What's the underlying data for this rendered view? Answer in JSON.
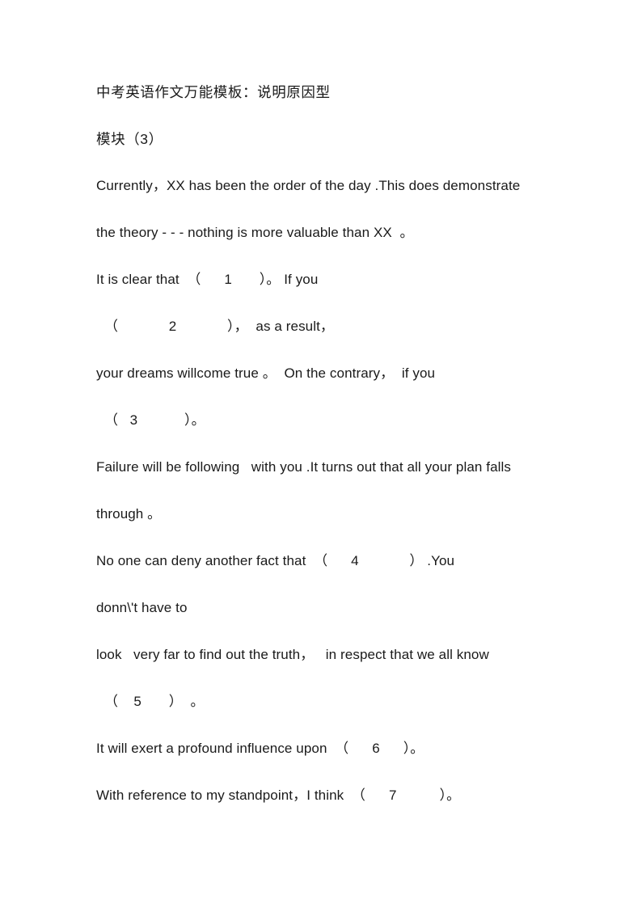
{
  "document": {
    "title": "中考英语作文万能模板：说明原因型",
    "section": "模块（3）",
    "text_color": "#1a1a1a",
    "background_color": "#ffffff",
    "lines": [
      {
        "id": "title",
        "text": "中考英语作文万能模板：说明原因型",
        "cjk": true,
        "indent": false
      },
      {
        "id": "module",
        "text": "模块（3）",
        "cjk": true,
        "indent": false
      },
      {
        "id": "p1l1",
        "text": "Currently，XX has been the order of the day .This does demonstrate",
        "cjk": false,
        "indent": false
      },
      {
        "id": "p1l2",
        "text": "the theory - - - nothing is more valuable than XX  。",
        "cjk": false,
        "indent": false
      },
      {
        "id": "p2l1",
        "text": "It is clear that  （      1       ）。 If you",
        "cjk": false,
        "indent": false
      },
      {
        "id": "p2l2",
        "text": "（             2             ），  as a result，",
        "cjk": false,
        "indent": true
      },
      {
        "id": "p3l1",
        "text": "your dreams willcome true 。  On the contrary，  if you",
        "cjk": false,
        "indent": false
      },
      {
        "id": "p3l2",
        "text": "（   3            ）。",
        "cjk": false,
        "indent": true
      },
      {
        "id": "p4l1",
        "text": "Failure will be following   with you .It turns out that all your plan falls",
        "cjk": false,
        "indent": false
      },
      {
        "id": "p4l2",
        "text": "through 。",
        "cjk": false,
        "indent": false
      },
      {
        "id": "p5l1",
        "text": "No one can deny another fact that  （      4             ） .You",
        "cjk": false,
        "indent": false
      },
      {
        "id": "p5l2",
        "text": "donn\\'t have to",
        "cjk": false,
        "indent": false
      },
      {
        "id": "p6l1",
        "text": "look   very far to find out the truth，   in respect that we all know",
        "cjk": false,
        "indent": false
      },
      {
        "id": "p6l2",
        "text": "（    5       ）  。",
        "cjk": false,
        "indent": true
      },
      {
        "id": "p7l1",
        "text": "It will exert a profound influence upon  （      6      ）。",
        "cjk": false,
        "indent": false
      },
      {
        "id": "p8l1",
        "text": "With reference to my standpoint，I think  （      7           ）。",
        "cjk": false,
        "indent": false
      }
    ]
  }
}
